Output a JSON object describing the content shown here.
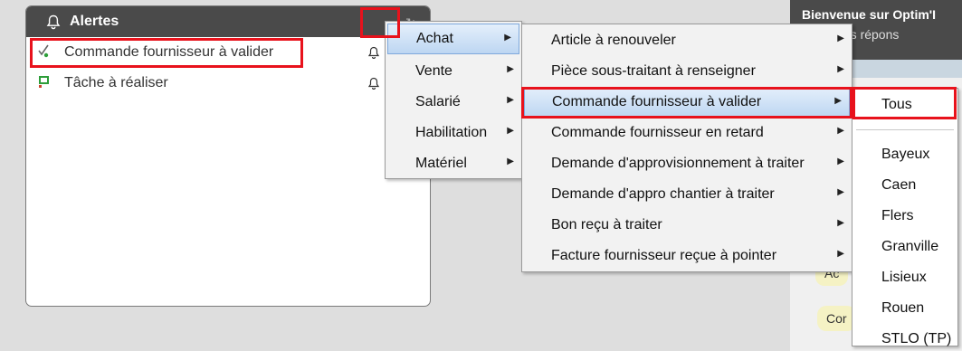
{
  "panel": {
    "title": "Alertes",
    "alerts": [
      {
        "label": "Commande fournisseur à valider"
      },
      {
        "label": "Tâche à réaliser"
      }
    ]
  },
  "welcome": {
    "title": "Bienvenue sur Optim'I",
    "subtitle": "vez ici les répons",
    "bubble1": "Ac",
    "bubble2": "Cor"
  },
  "menu1": [
    "Achat",
    "Vente",
    "Salarié",
    "Habilitation",
    "Matériel"
  ],
  "menu2": [
    "Article à renouveler",
    "Pièce sous-traitant à renseigner",
    "Commande fournisseur à valider",
    "Commande fournisseur en retard",
    "Demande d'approvisionnement à traiter",
    "Demande d'appro chantier à traiter",
    "Bon reçu à traiter",
    "Facture fournisseur reçue à pointer"
  ],
  "menu3": {
    "all": "Tous",
    "sites": [
      "Bayeux",
      "Caen",
      "Flers",
      "Granville",
      "Lisieux",
      "Rouen",
      "STLO (TP)"
    ]
  },
  "colors": {
    "highlight_box": "#e8121c",
    "header": "#4a4a4a",
    "menu_highlight": "#bdd6f2"
  }
}
